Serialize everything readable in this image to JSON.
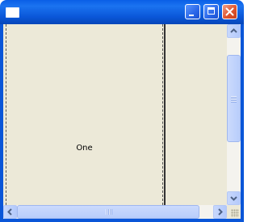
{
  "window": {
    "title": "",
    "controls": {
      "minimize": "minimize-icon",
      "maximize": "maximize-icon",
      "close": "close-icon"
    }
  },
  "panes": [
    {
      "label": "One"
    },
    {
      "label": ""
    }
  ],
  "colors": {
    "titlebar": "#0a56d8",
    "client_background": "#ece9d8",
    "close_button": "#e1552e",
    "scrollbar_thumb": "#b8cdfb"
  }
}
